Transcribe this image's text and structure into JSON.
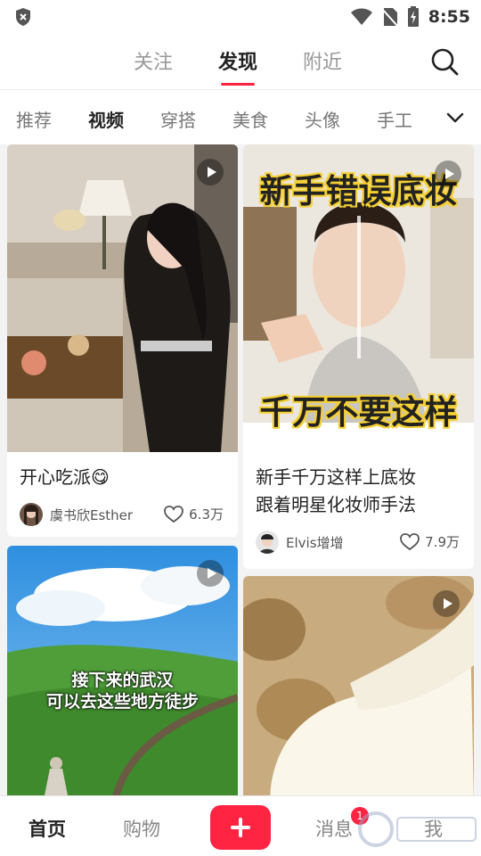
{
  "status_bar": {
    "time": "8:55"
  },
  "top_tabs": [
    "关注",
    "发现",
    "附近"
  ],
  "categories": [
    "推荐",
    "视频",
    "穿搭",
    "美食",
    "头像",
    "手工"
  ],
  "cards": [
    {
      "title": "开心吃派😋",
      "author": "虞书欣Esther",
      "likes": "6.3万"
    },
    {
      "title_line1": "新手千万这样上底妆",
      "title_line2": "跟着明星化妆师手法",
      "author": "Elvis增增",
      "likes": "7.9万",
      "overlay_top": "新手错误底妆",
      "overlay_bottom": "千万不要这样"
    },
    {
      "overlay_line1": "接下来的武汉",
      "overlay_line2": "可以去这些地方徒步"
    },
    {}
  ],
  "bottom_nav": {
    "home": "首页",
    "shop": "购物",
    "messages": "消息",
    "me": "我",
    "messages_badge": "1"
  },
  "colors": {
    "accent": "#ff2442"
  }
}
